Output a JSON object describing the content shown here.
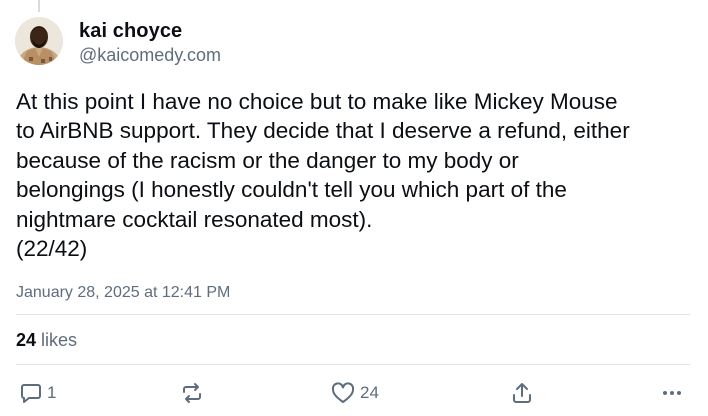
{
  "author": {
    "name": "kai choyce",
    "handle": "@kaicomedy.com",
    "avatar_icon": "avatar-photo"
  },
  "post": {
    "text": "At this point I have no choice but to make like Mickey Mouse\nto AirBNB support. They decide that I deserve a refund, either\nbecause of the racism or the danger to my body or\nbelongings (I honestly couldn't tell you which part of the\nnightmare cocktail resonated most).\n(22/42)",
    "date": "January 28, 2025 at 12:41 PM"
  },
  "stats": {
    "likes_count": "24",
    "likes_label": "likes"
  },
  "actions": {
    "reply_icon": "reply-icon",
    "reply_count": "1",
    "repost_icon": "repost-icon",
    "like_icon": "heart-icon",
    "like_count": "24",
    "share_icon": "share-icon",
    "more_icon": "more-icon"
  },
  "colors": {
    "text": "#0b0f14",
    "muted": "#5e6d7e",
    "divider": "#dfe4ea"
  }
}
